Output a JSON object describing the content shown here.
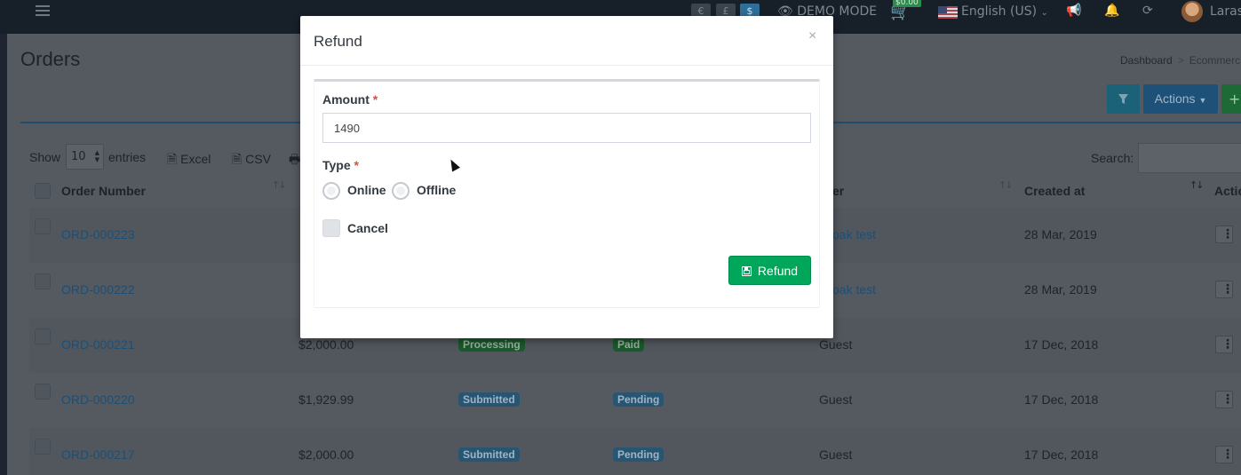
{
  "topbar": {
    "currencies": [
      "€",
      "£",
      "$"
    ],
    "demo_mode": "DEMO MODE",
    "cart_total": "$0.00",
    "language": "English (US)",
    "user_name": "Laras"
  },
  "page": {
    "title": "Orders",
    "breadcrumb": [
      "Dashboard",
      "Ecommerc"
    ]
  },
  "actions": {
    "actions_label": "Actions",
    "add_label": "+"
  },
  "table_controls": {
    "show_label": "Show",
    "entries_value": "10",
    "entries_label": "entries",
    "excel_label": "Excel",
    "csv_label": "CSV",
    "search_label": "Search:"
  },
  "table": {
    "headers": {
      "order_number": "Order Number",
      "customer": "er",
      "created_at": "Created at",
      "actions": "Actio"
    },
    "rows": [
      {
        "order": "ORD-000223",
        "total": "",
        "status": "",
        "payment": "",
        "customer": "oak test",
        "created": "28 Mar, 2019"
      },
      {
        "order": "ORD-000222",
        "total": "",
        "status": "",
        "payment": "",
        "customer": "oak test",
        "created": "28 Mar, 2019"
      },
      {
        "order": "ORD-000221",
        "total": "$2,000.00",
        "status": "Processing",
        "payment": "Paid",
        "customer": "Guest",
        "created": "17 Dec, 2018"
      },
      {
        "order": "ORD-000220",
        "total": "$1,929.99",
        "status": "Submitted",
        "payment": "Pending",
        "customer": "Guest",
        "created": "17 Dec, 2018"
      },
      {
        "order": "ORD-000217",
        "total": "$2,000.00",
        "status": "Submitted",
        "payment": "Pending",
        "customer": "Guest",
        "created": "17 Dec, 2018"
      }
    ]
  },
  "modal": {
    "title": "Refund",
    "close_symbol": "×",
    "amount_label": "Amount",
    "required_mark": "*",
    "amount_value": "1490",
    "type_label": "Type",
    "option_online": "Online",
    "option_offline": "Offline",
    "cancel_label": "Cancel",
    "submit_label": "Refund"
  },
  "colors": {
    "submit_green": "#00a65a",
    "required_red": "#dd4b39"
  }
}
